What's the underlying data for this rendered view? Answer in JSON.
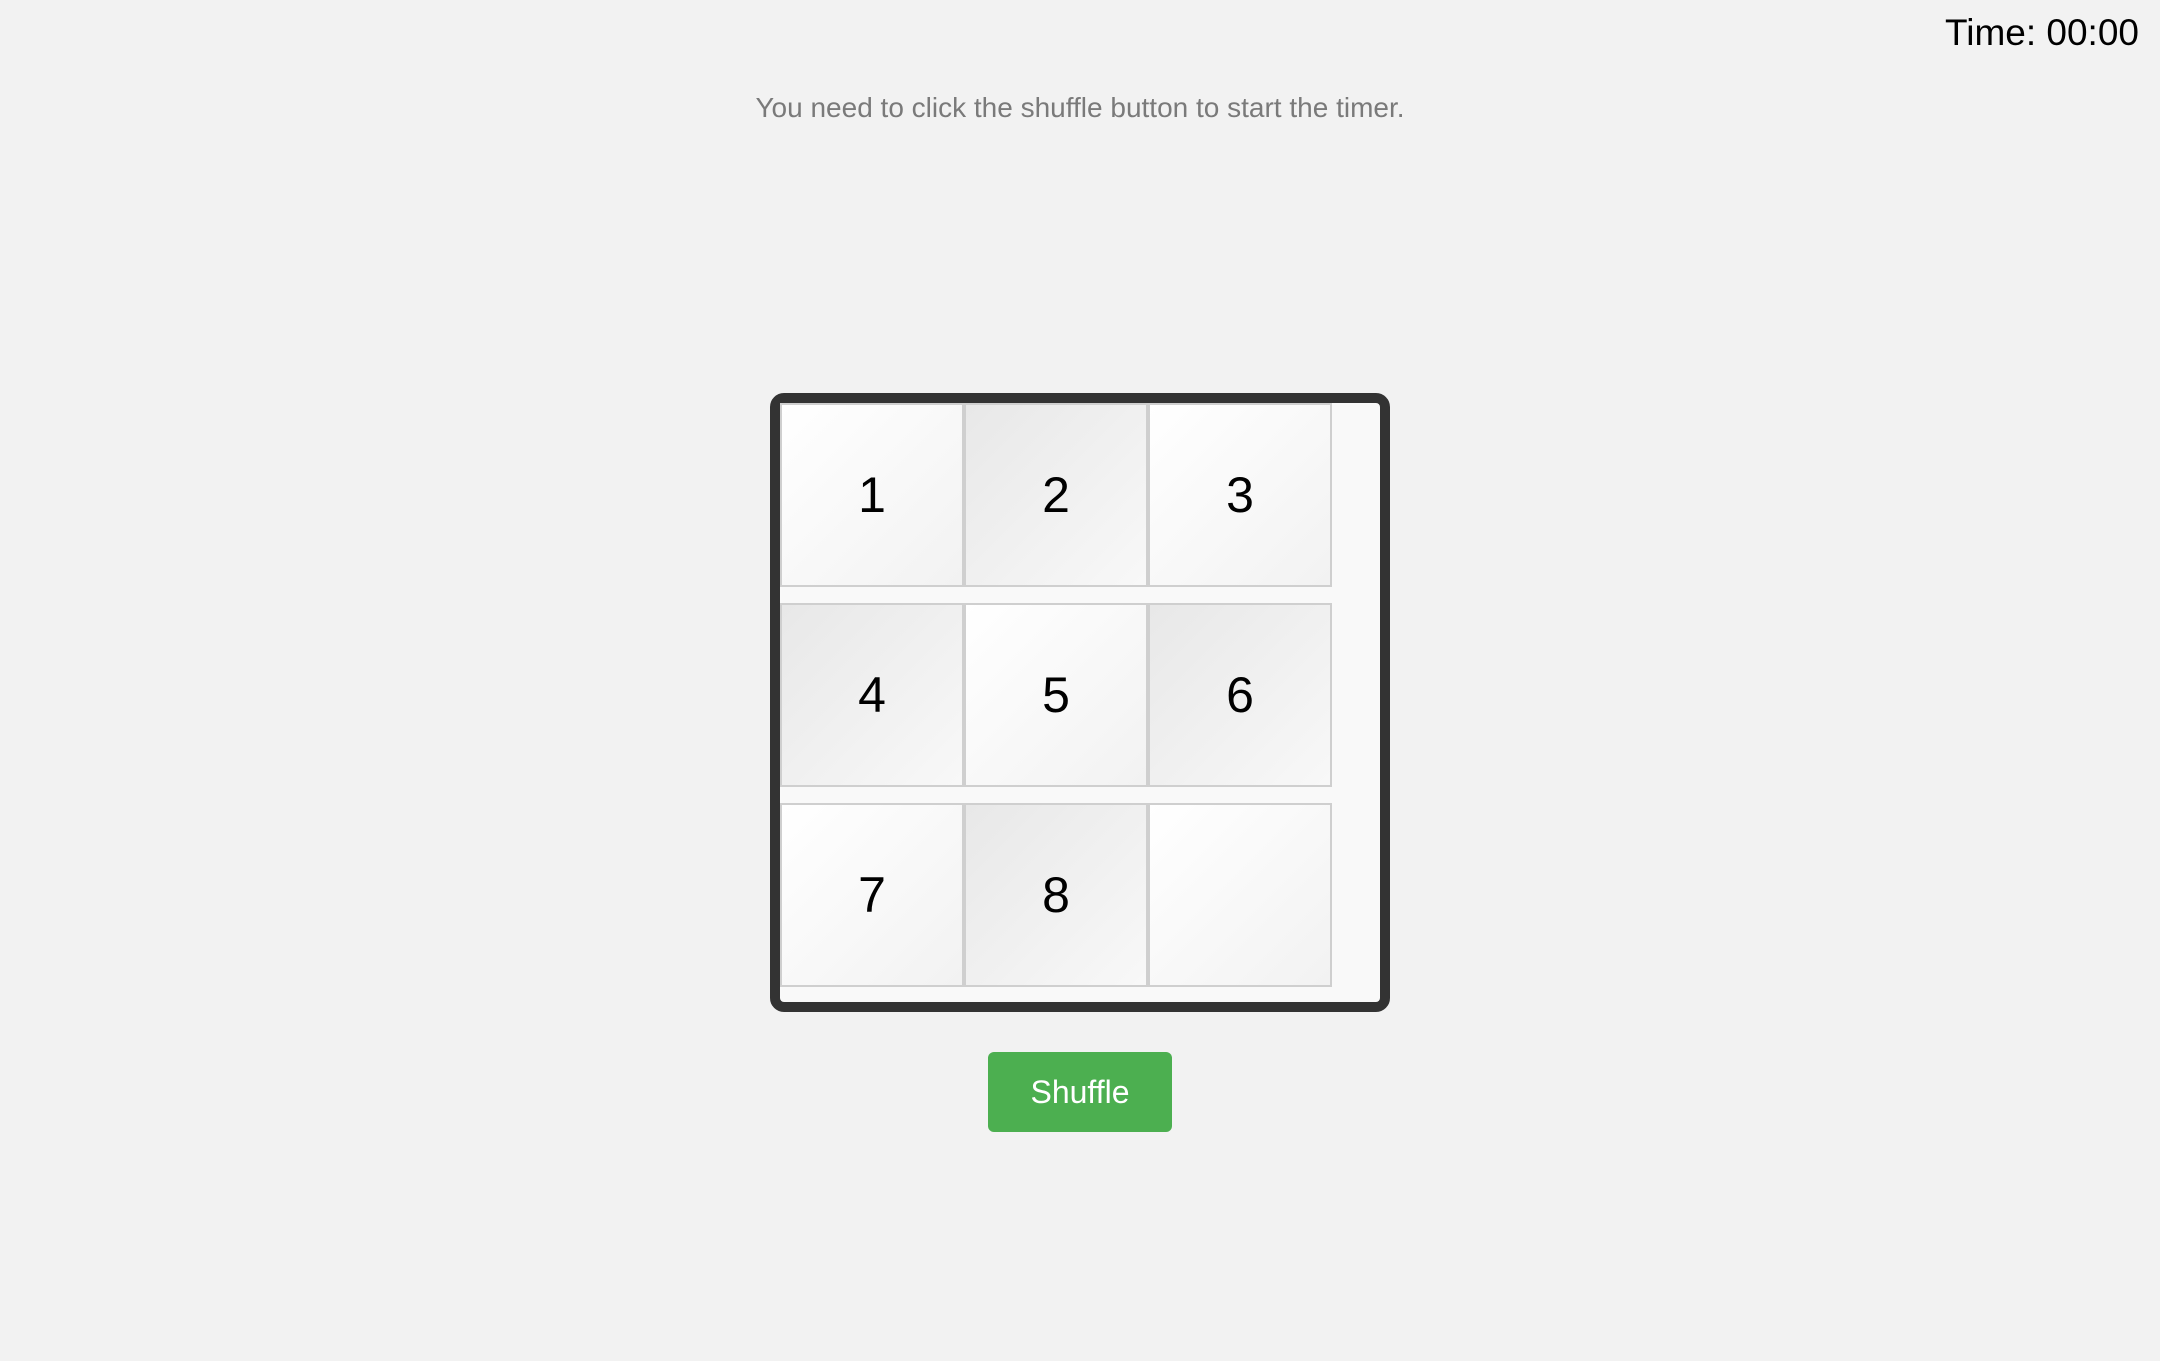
{
  "timer": {
    "label": "Time: 00:00"
  },
  "instructions": "You need to click the shuffle button to start the timer.",
  "board": {
    "tiles": [
      {
        "label": "1",
        "shade": "light"
      },
      {
        "label": "2",
        "shade": "dark"
      },
      {
        "label": "3",
        "shade": "light"
      },
      {
        "label": "4",
        "shade": "dark"
      },
      {
        "label": "5",
        "shade": "light"
      },
      {
        "label": "6",
        "shade": "dark"
      },
      {
        "label": "7",
        "shade": "light"
      },
      {
        "label": "8",
        "shade": "dark"
      },
      {
        "label": "",
        "shade": "light"
      }
    ]
  },
  "controls": {
    "shuffle_label": "Shuffle"
  },
  "colors": {
    "background": "#f2f2f2",
    "board_frame": "#333333",
    "shuffle_button": "#4caf50",
    "hint_text": "#7a7a7a"
  }
}
